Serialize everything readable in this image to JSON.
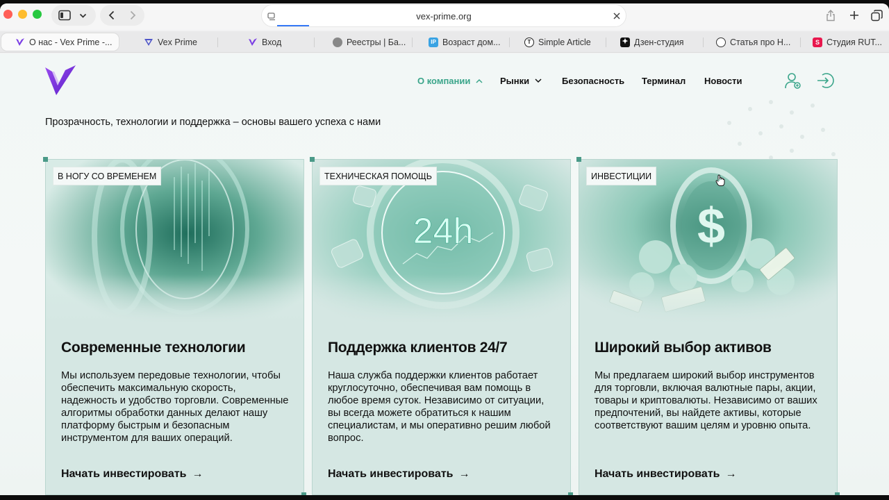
{
  "browser": {
    "url": "vex-prime.org",
    "tabs": [
      {
        "label": "О нас - Vex Prime -...",
        "icon": "vex-logo-icon",
        "active": true
      },
      {
        "label": "Vex Prime",
        "icon": "vex-logo-icon"
      },
      {
        "label": "Вход",
        "icon": "vex-logo-icon"
      },
      {
        "label": "Реестры | Ба...",
        "icon": "bank-emblem-icon"
      },
      {
        "label": "Возраст дом...",
        "icon": "ip-icon"
      },
      {
        "label": "Simple Article",
        "icon": "simple-article-icon"
      },
      {
        "label": "Дзен-студия",
        "icon": "dzen-icon"
      },
      {
        "label": "Статья про Н...",
        "icon": "openai-icon"
      },
      {
        "label": "Студия RUT...",
        "icon": "rutube-icon"
      }
    ]
  },
  "header": {
    "nav": [
      {
        "label": "О компании",
        "has_dropdown": true,
        "active": true
      },
      {
        "label": "Рынки",
        "has_dropdown": true
      },
      {
        "label": "Безопасность"
      },
      {
        "label": "Терминал"
      },
      {
        "label": "Новости"
      }
    ],
    "accent_color": "#3aa58a"
  },
  "main": {
    "tagline": "Прозрачность, технологии и поддержка – основы вашего успеха с нами",
    "cards": [
      {
        "tag": "В НОГУ СО ВРЕМЕНЕМ",
        "title": "Современные технологии",
        "text": "Мы используем передовые технологии, чтобы обеспечить максимальную скорость, надежность и удобство торговли. Современные алгоритмы обработки данных делают нашу платформу быстрым и безопасным инструментом для ваших операций.",
        "cta": "Начать инвестировать",
        "arrow": "→"
      },
      {
        "tag": "ТЕХНИЧЕСКАЯ ПОМОЩЬ",
        "title": "Поддержка клиентов 24/7",
        "text": "Наша служба поддержки клиентов работает круглосуточно, обеспечивая вам помощь в любое время суток. Независимо от ситуации, вы всегда можете обратиться к нашим специалистам, и мы оперативно решим любой вопрос.",
        "cta": "Начать инвестировать",
        "arrow": "→",
        "image_text": "24h"
      },
      {
        "tag": "ИНВЕСТИЦИИ",
        "title": "Широкий выбор активов",
        "text": "Мы предлагаем широкий выбор инструментов для торговли, включая валютные пары, акции, товары и криптовалюты. Независимо от ваших предпочтений, вы найдете активы, которые соответствуют вашим целям и уровню опыта.",
        "cta": "Начать инвестировать",
        "arrow": "→",
        "image_text": "$"
      }
    ]
  }
}
